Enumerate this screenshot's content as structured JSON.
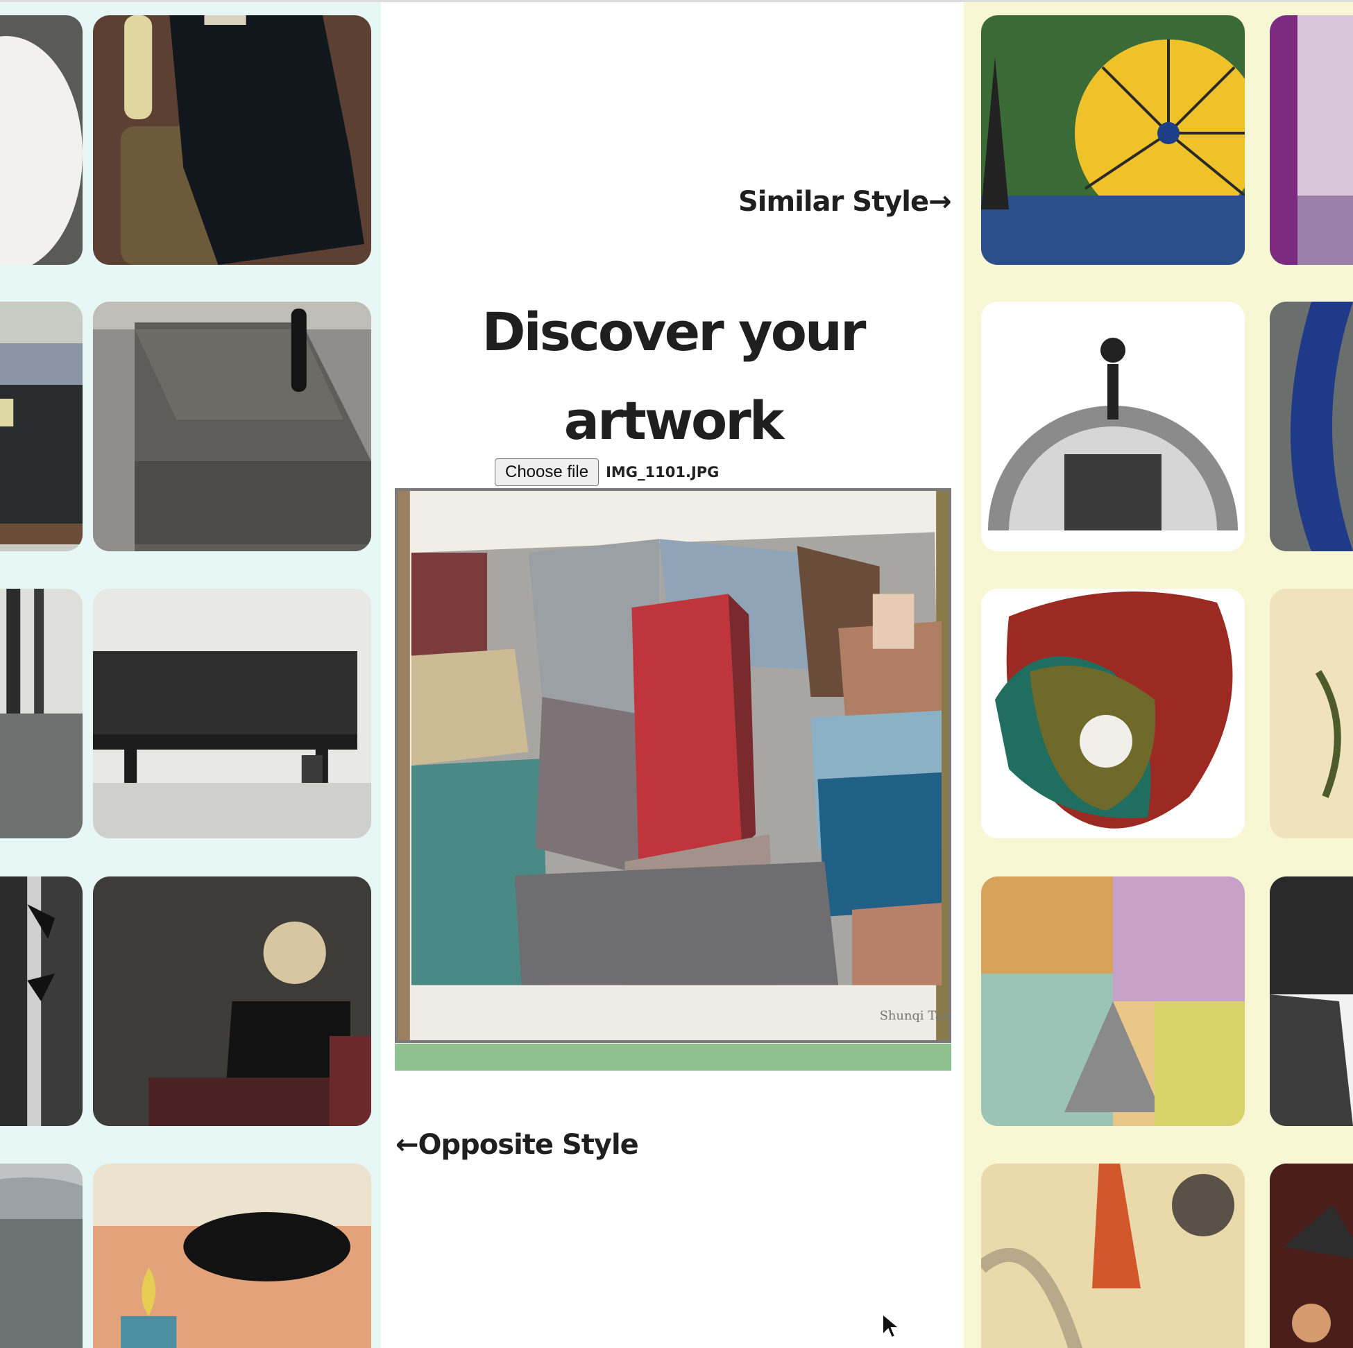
{
  "page": {
    "title_line1": "Discover your",
    "title_line2": "artwork",
    "similar_label": "Similar Style",
    "similar_arrow": "→",
    "opposite_label": "Opposite Style",
    "opposite_arrow": "←"
  },
  "upload": {
    "button_label": "Choose file",
    "file_name": "IMG_1101.JPG"
  },
  "progress": {
    "value": 1.0,
    "color": "#8fc08f"
  },
  "colors": {
    "left_panel": "#e7f7f6",
    "right_panel": "#f8f7d4",
    "text": "#1f1f1f"
  },
  "artwork": {
    "signature": "Shunqi Tang"
  }
}
